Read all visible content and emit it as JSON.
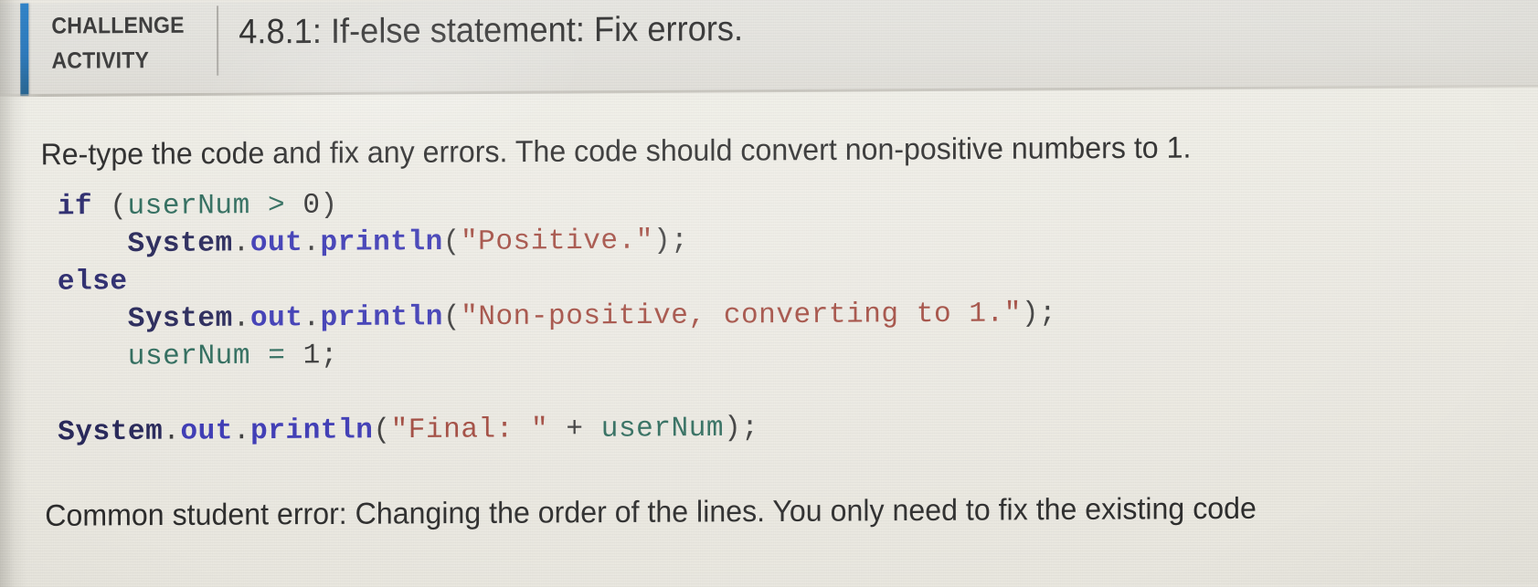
{
  "header": {
    "badge_line1": "CHALLENGE",
    "badge_line2": "ACTIVITY",
    "title": "4.8.1: If-else statement: Fix errors.",
    "accent_color": "#2a79bd",
    "background_color": "#e2e1dc"
  },
  "main": {
    "prompt": "Re-type the code and fix any errors. The code should convert non-positive numbers to 1.",
    "footer_note": "Common student error: Changing the order of the lines. You only need to fix the existing code",
    "background_color": "#eceae3"
  },
  "code": {
    "language": "java",
    "colors": {
      "keyword": "#2b2a6e",
      "class": "#262659",
      "member": "#3b38b5",
      "identifier": "#2d6b5c",
      "string": "#a1483d",
      "number": "#333333",
      "punctuation": "#3a3a3a"
    },
    "plain_text": "if (userNum > 0)\n    System.out.println(\"Positive.\");\nelse\n    System.out.println(\"Non-positive, converting to 1.\");\n    userNum = 1;\n\nSystem.out.println(\"Final: \" + userNum);",
    "lines": [
      {
        "id": "code-line-1",
        "tokens": [
          {
            "t": "if",
            "k": "kw"
          },
          {
            "t": " ",
            "k": "punct"
          },
          {
            "t": "(",
            "k": "punct"
          },
          {
            "t": "userNum",
            "k": "id"
          },
          {
            "t": " ",
            "k": "punct"
          },
          {
            "t": ">",
            "k": "op"
          },
          {
            "t": " ",
            "k": "punct"
          },
          {
            "t": "0",
            "k": "num"
          },
          {
            "t": ")",
            "k": "punct"
          }
        ]
      },
      {
        "id": "code-line-2",
        "tokens": [
          {
            "t": "    ",
            "k": "punct"
          },
          {
            "t": "System",
            "k": "cls"
          },
          {
            "t": ".",
            "k": "punct"
          },
          {
            "t": "out",
            "k": "mem"
          },
          {
            "t": ".",
            "k": "punct"
          },
          {
            "t": "println",
            "k": "mem"
          },
          {
            "t": "(",
            "k": "punct"
          },
          {
            "t": "\"Positive.\"",
            "k": "str"
          },
          {
            "t": ")",
            "k": "punct"
          },
          {
            "t": ";",
            "k": "punct"
          }
        ]
      },
      {
        "id": "code-line-3",
        "tokens": [
          {
            "t": "else",
            "k": "kw"
          }
        ]
      },
      {
        "id": "code-line-4",
        "tokens": [
          {
            "t": "    ",
            "k": "punct"
          },
          {
            "t": "System",
            "k": "cls"
          },
          {
            "t": ".",
            "k": "punct"
          },
          {
            "t": "out",
            "k": "mem"
          },
          {
            "t": ".",
            "k": "punct"
          },
          {
            "t": "println",
            "k": "mem"
          },
          {
            "t": "(",
            "k": "punct"
          },
          {
            "t": "\"Non-positive, converting to 1.\"",
            "k": "str"
          },
          {
            "t": ")",
            "k": "punct"
          },
          {
            "t": ";",
            "k": "punct"
          }
        ]
      },
      {
        "id": "code-line-5",
        "tokens": [
          {
            "t": "    ",
            "k": "punct"
          },
          {
            "t": "userNum",
            "k": "id"
          },
          {
            "t": " ",
            "k": "punct"
          },
          {
            "t": "=",
            "k": "op"
          },
          {
            "t": " ",
            "k": "punct"
          },
          {
            "t": "1",
            "k": "num"
          },
          {
            "t": ";",
            "k": "punct"
          }
        ]
      },
      {
        "id": "code-line-6",
        "tokens": []
      },
      {
        "id": "code-line-7",
        "tokens": [
          {
            "t": "System",
            "k": "cls"
          },
          {
            "t": ".",
            "k": "punct"
          },
          {
            "t": "out",
            "k": "mem"
          },
          {
            "t": ".",
            "k": "punct"
          },
          {
            "t": "println",
            "k": "mem"
          },
          {
            "t": "(",
            "k": "punct"
          },
          {
            "t": "\"Final: \"",
            "k": "str"
          },
          {
            "t": " ",
            "k": "punct"
          },
          {
            "t": "+",
            "k": "punct"
          },
          {
            "t": " ",
            "k": "punct"
          },
          {
            "t": "userNum",
            "k": "id"
          },
          {
            "t": ")",
            "k": "punct"
          },
          {
            "t": ";",
            "k": "punct"
          }
        ]
      }
    ]
  }
}
